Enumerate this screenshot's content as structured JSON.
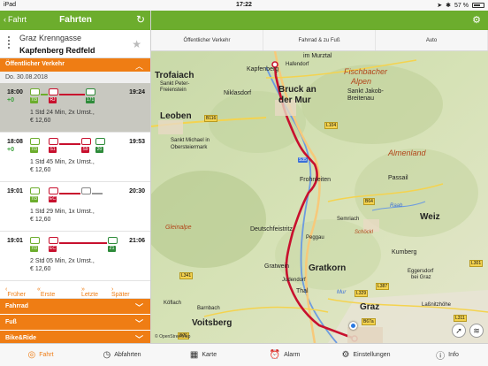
{
  "status": {
    "device": "iPad",
    "wifi": "wifi",
    "time": "17:22",
    "battery": "57 %",
    "battery_level": 0.57
  },
  "left": {
    "back_label": "Fahrt",
    "title": "Fahrten",
    "route": {
      "from": "Graz Krenngasse",
      "to": "Kapfenberg Redfeld"
    },
    "section": "Öffentlicher Verkehr",
    "date": "Do. 30.08.2018",
    "connections": [
      {
        "dep": "18:00",
        "delay": "+0",
        "arr": "19:24",
        "duration": "1 Std 24 Min,",
        "changes": "2x Umst.,",
        "price": "€ 12,60",
        "badges": [
          "7/3",
          "RJ",
          "171"
        ]
      },
      {
        "dep": "18:08",
        "delay": "+0",
        "arr": "19:53",
        "duration": "1 Std 45 Min,",
        "changes": "2x Umst.,",
        "price": "€ 12,60",
        "badges": [
          "7/3",
          "S1",
          "S9",
          "20"
        ]
      },
      {
        "dep": "19:01",
        "delay": "",
        "arr": "20:30",
        "duration": "1 Std 29 Min,",
        "changes": "1x Umst.,",
        "price": "€ 12,60",
        "badges": [
          "7/3",
          "EC"
        ]
      },
      {
        "dep": "19:01",
        "delay": "",
        "arr": "21:06",
        "duration": "2 Std 05 Min,",
        "changes": "2x Umst.,",
        "price": "€ 12,60",
        "badges": [
          "7/3",
          "EC",
          "Z1"
        ]
      }
    ],
    "pager": {
      "earlier": "Früher",
      "first": "Erste",
      "last": "Letzte",
      "later": "Später"
    },
    "groups": [
      "Fahrrad",
      "Fuß",
      "Bike&Ride"
    ]
  },
  "right": {
    "modes": [
      "Öffentlicher Verkehr",
      "Fahrrad & zu Fuß",
      "Auto"
    ],
    "map_labels": {
      "murztal": "im Murztal",
      "hafendorf": "Hafendorf",
      "kapfenberg": "Kapfenberg",
      "trofaiach": "Trofaiach",
      "peter": "Sankt Peter-",
      "freienstein": "Freienstein",
      "niklasdorf": "Niklasdorf",
      "bruck1": "Bruck an",
      "bruck2": "der Mur",
      "fischbacher1": "Fischbacher",
      "fischbacher2": "Alpen",
      "jakob1": "Sankt Jakob-",
      "jakob2": "Breitenau",
      "leoben": "Leoben",
      "michael1": "Sankt Michael in",
      "michael2": "Obersteiermark",
      "almenland": "Almenland",
      "frohnleiten": "Frohnleiten",
      "passail": "Passail",
      "semriach": "Semriach",
      "weiz": "Weiz",
      "schockl": "Schöckl",
      "gleinalpe": "Gleinalpe",
      "deutschfeistritz": "Deutschfeistritz",
      "peggau": "Peggau",
      "kumberg": "Kumberg",
      "eggersdorf1": "Eggersdorf",
      "eggersdorf2": "bei Graz",
      "gratwein": "Gratwein",
      "gratkorn": "Gratkorn",
      "judendorf": "Judendorf",
      "thal": "Thal",
      "koflach": "Köflach",
      "barnbach": "Barnbach",
      "voitsberg": "Voitsberg",
      "graz": "Graz",
      "lassnitzhohe": "Laßnitzhöhe",
      "raab": "Raab",
      "mur": "Mur",
      "attribution": "© OpenStreetMap"
    },
    "roads": [
      "B116",
      "L104",
      "S35",
      "B64",
      "L341",
      "L387",
      "L329",
      "B67a",
      "B70",
      "L301",
      "L311"
    ]
  },
  "tabs": [
    {
      "label": "Fahrt",
      "icon": "compass-icon",
      "active": true
    },
    {
      "label": "Abfahrten",
      "icon": "clock-icon",
      "active": false
    },
    {
      "label": "Karte",
      "icon": "map-icon",
      "active": false
    },
    {
      "label": "Alarm",
      "icon": "alarm-icon",
      "active": false
    },
    {
      "label": "Einstellungen",
      "icon": "gear-icon",
      "active": false
    },
    {
      "label": "Info",
      "icon": "info-icon",
      "active": false
    }
  ],
  "colors": {
    "brand_green": "#6cad2d",
    "accent_orange": "#ef7d14",
    "route_red": "#c8102e"
  }
}
